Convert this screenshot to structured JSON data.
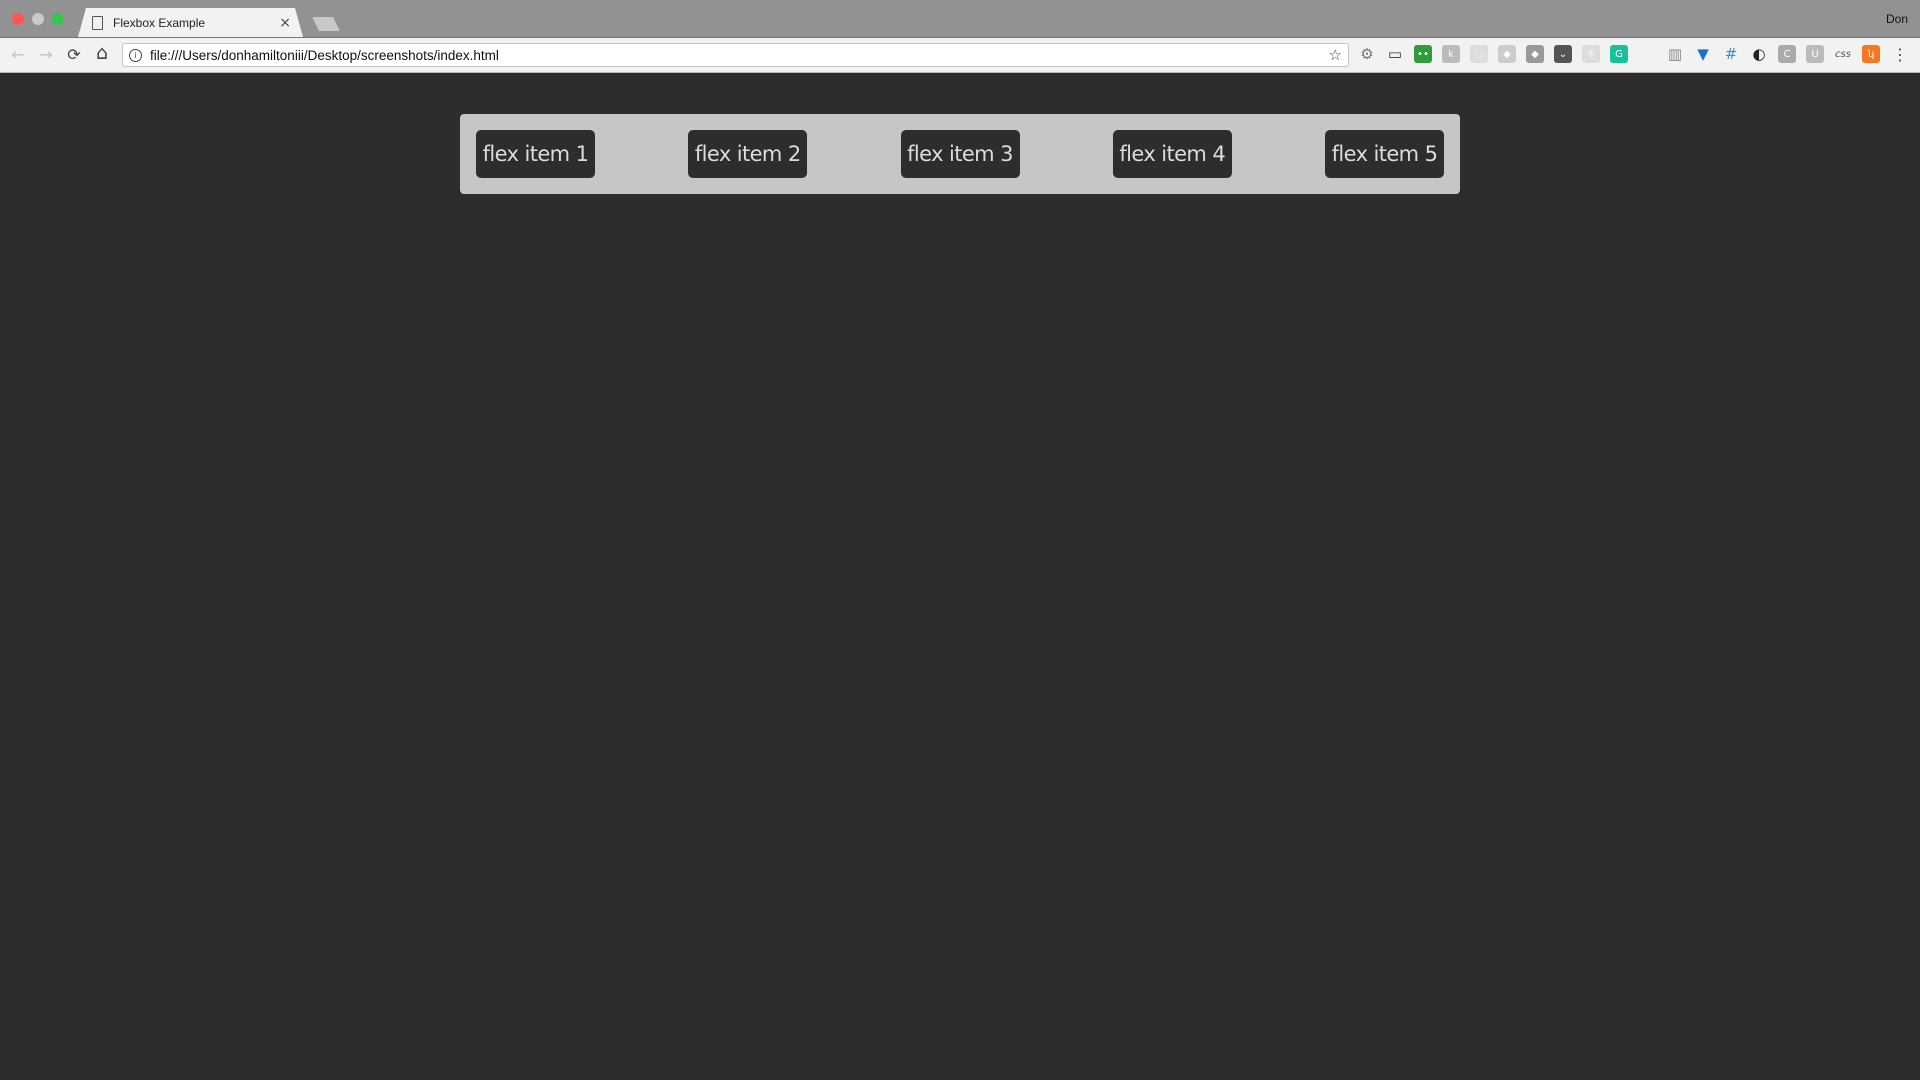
{
  "window": {
    "user_name": "Don",
    "traffic_lights": {
      "close": "#fc5753",
      "minimize": "#c9c9c9",
      "maximize": "#34c84a"
    }
  },
  "tab": {
    "title": "Flexbox Example",
    "close_glyph": "×"
  },
  "toolbar": {
    "back_glyph": "←",
    "forward_glyph": "→",
    "reload_glyph": "⟳",
    "home_glyph": "⌂",
    "url": "file:///Users/donhamiltoniii/Desktop/screenshots/index.html",
    "star_glyph": "☆",
    "menu_glyph": "⋮",
    "extensions": [
      {
        "name": "settings-gear",
        "color": "#777777",
        "glyph": "⚙"
      },
      {
        "name": "screenshot",
        "color": "#333333",
        "glyph": "▭"
      },
      {
        "name": "green-robot",
        "color": "#2e9d3a",
        "glyph": "••"
      },
      {
        "name": "k-extension",
        "color": "#bbbbbb",
        "glyph": "k"
      },
      {
        "name": "swirl",
        "color": "#dddddd",
        "glyph": "◌"
      },
      {
        "name": "dropbox",
        "color": "#cccccc",
        "glyph": "◆"
      },
      {
        "name": "layers",
        "color": "#999999",
        "glyph": "◆"
      },
      {
        "name": "pocket",
        "color": "#555555",
        "glyph": "⌄"
      },
      {
        "name": "react",
        "color": "#dddddd",
        "glyph": "⚛"
      },
      {
        "name": "grammarly",
        "color": "#15c39a",
        "glyph": "G"
      },
      {
        "name": "rainbow",
        "color": "#eeeeee",
        "glyph": "⌒"
      },
      {
        "name": "book",
        "color": "#888888",
        "glyph": "▥"
      },
      {
        "name": "vue-devtools",
        "color": "#1a73c8",
        "glyph": "▼"
      },
      {
        "name": "grid",
        "color": "#3b8fd0",
        "glyph": "#"
      },
      {
        "name": "contrast",
        "color": "#222222",
        "glyph": "◐"
      },
      {
        "name": "c-circle",
        "color": "#aaaaaa",
        "glyph": "C"
      },
      {
        "name": "u-box",
        "color": "#bbbbbb",
        "glyph": "U"
      },
      {
        "name": "css",
        "color": "#f2f2f2",
        "glyph": "css"
      },
      {
        "name": "hubspot",
        "color": "#f57722",
        "glyph": "ʮ"
      }
    ]
  },
  "page": {
    "background": "#2d2d2d",
    "container_background": "#c6c6c6",
    "items": [
      "flex item 1",
      "flex item 2",
      "flex item 3",
      "flex item 4",
      "flex item 5"
    ]
  }
}
